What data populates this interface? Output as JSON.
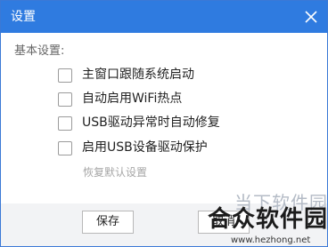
{
  "dialog": {
    "title": "设置",
    "close_icon": "close-icon"
  },
  "basic": {
    "section_label": "基本设置:",
    "options": [
      {
        "label": "主窗口跟随系统启动",
        "checked": false
      },
      {
        "label": "自动启用WiFi热点",
        "checked": false
      },
      {
        "label": "USB驱动异常时自动修复",
        "checked": false
      },
      {
        "label": "启用USB设备驱动保护",
        "checked": false
      }
    ],
    "restore_defaults": "恢复默认设置"
  },
  "footer": {
    "save_label": "保存",
    "cancel_label": "取消"
  },
  "watermark": {
    "upper_text": "当下软件园",
    "main_text": "合众软件园",
    "url": "www.hezhong.net"
  },
  "colors": {
    "title_bar": "#2f7be0",
    "footer_bg": "#f2f3f5",
    "border": "#3b79d6"
  }
}
